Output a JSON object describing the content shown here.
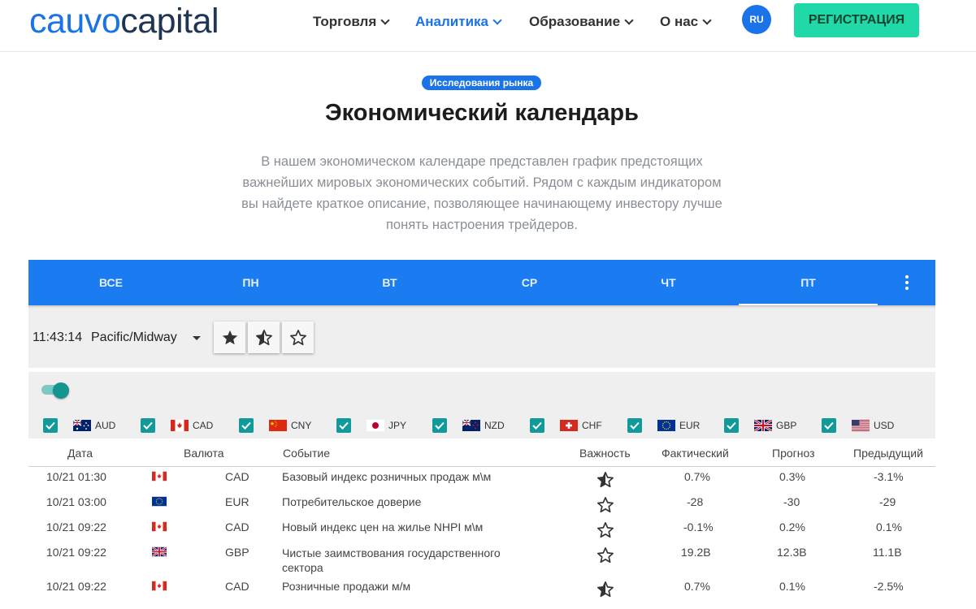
{
  "header": {
    "logo_part1": "cauvo",
    "logo_part2": "capital",
    "nav": [
      {
        "label": "Торговля"
      },
      {
        "label": "Аналитика"
      },
      {
        "label": "Образование"
      },
      {
        "label": "О нас"
      }
    ],
    "lang": "RU",
    "register": "РЕГИСТРАЦИЯ"
  },
  "hero": {
    "badge": "Исследования рынка",
    "title": "Экономический календарь",
    "description": "В нашем экономическом календаре представлен график предстоящих важнейших мировых экономических событий. Рядом с каждым индикатором вы найдете краткое описание, позволяющее начинающему инвестору лучше понять настроения трейдеров."
  },
  "tabs": [
    {
      "label": "ВСЕ"
    },
    {
      "label": "ПН"
    },
    {
      "label": "ВТ"
    },
    {
      "label": "СР"
    },
    {
      "label": "ЧТ"
    },
    {
      "label": "ПТ",
      "active": true
    }
  ],
  "toolbar": {
    "clock": "11:43:14",
    "timezone": "Pacific/Midway",
    "importance_buttons": [
      "star-filled-icon",
      "star-half-icon",
      "star-outline-icon"
    ]
  },
  "currency_filters": [
    {
      "code": "AUD",
      "checked": true
    },
    {
      "code": "CAD",
      "checked": true
    },
    {
      "code": "CNY",
      "checked": true
    },
    {
      "code": "JPY",
      "checked": true
    },
    {
      "code": "NZD",
      "checked": true
    },
    {
      "code": "CHF",
      "checked": true
    },
    {
      "code": "EUR",
      "checked": true
    },
    {
      "code": "GBP",
      "checked": true
    },
    {
      "code": "USD",
      "checked": true
    }
  ],
  "table": {
    "headers": {
      "date": "Дата",
      "currency": "Валюта",
      "event": "Событие",
      "importance": "Важность",
      "actual": "Фактический",
      "forecast": "Прогноз",
      "previous": "Предыдущий"
    },
    "rows": [
      {
        "date": "10/21 01:30",
        "currency": "CAD",
        "event": "Базовый индекс розничных продаж м\\м",
        "importance": "half",
        "actual": "0.7%",
        "forecast": "0.3%",
        "previous": "-3.1%"
      },
      {
        "date": "10/21 03:00",
        "currency": "EUR",
        "event": "Потребительское доверие",
        "importance": "low",
        "actual": "-28",
        "forecast": "-30",
        "previous": "-29"
      },
      {
        "date": "10/21 09:22",
        "currency": "CAD",
        "event": "Новый индекс цен на жилье NHPI м\\м",
        "importance": "low",
        "actual": "-0.1%",
        "forecast": "0.2%",
        "previous": "0.1%"
      },
      {
        "date": "10/21 09:22",
        "currency": "GBP",
        "event": "Чистые заимствования государственного сектора",
        "importance": "low",
        "actual": "19.2B",
        "forecast": "12.3B",
        "previous": "11.1B"
      },
      {
        "date": "10/21 09:22",
        "currency": "CAD",
        "event": "Розничные продажи м/м",
        "importance": "half",
        "actual": "0.7%",
        "forecast": "0.1%",
        "previous": "-2.5%"
      }
    ]
  },
  "colors": {
    "accent": "#1a73e8",
    "tabs_bg": "#1a7cf0",
    "register_bg": "#20d8a8",
    "checkbox": "#129a9a",
    "toggle": "#14958f",
    "panel_bg": "#efefef"
  }
}
